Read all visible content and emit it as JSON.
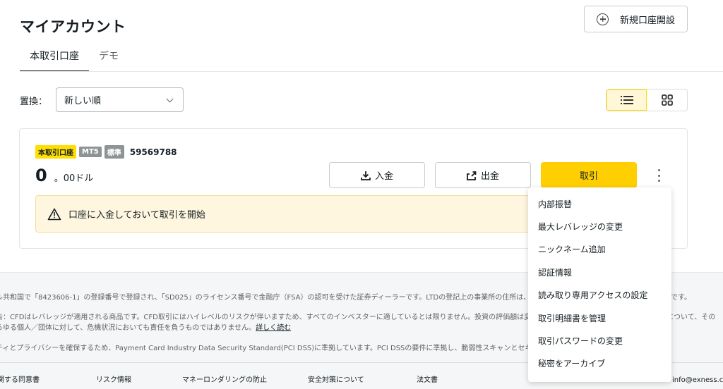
{
  "header": {
    "title": "マイアカウント",
    "new_account_label": "新規口座開設"
  },
  "tabs": [
    {
      "label": "本取引口座",
      "active": true
    },
    {
      "label": "デモ",
      "active": false
    }
  ],
  "sort": {
    "label": "置換：",
    "value": "新しい順"
  },
  "view_toggle": {
    "active": "list"
  },
  "account": {
    "badges": [
      "本取引口座",
      "MT5",
      "標準"
    ],
    "number": "59569788",
    "balance_int": "0",
    "balance_dec": "。00ドル",
    "deposit_label": "入金",
    "withdraw_label": "出金",
    "trade_label": "取引",
    "warning": "口座に入金しておいて取引を開始"
  },
  "menu": {
    "items": [
      "内部振替",
      "最大レバレッジの変更",
      "ニックネーム追加",
      "認証情報",
      "読み取り専用アクセスの設定",
      "取引明細書を管理",
      "取引パスワードの変更",
      "秘密をアーカイブ"
    ]
  },
  "footer": {
    "line1": "ル共和国で「8423606-1」の登録番号で登録され、「SD025」のライセンス番号で金融庁（FSA）の認可を受けた証券ディーラーです。LTDの登記上の事業所の住所は、9A CT Hou",
    "line1_tail": "です。",
    "line2": "告：CFDはレバレッジが適用される商品です。CFD取引にはハイレベルのリスクが伴いますため、すべてのインベスターに適しているとは限りません。投資の評価額は変動するものであり、投",
    "line2_tail": "について、その",
    "line3": "らゆる個人／団体に対して、危機状況においても責任を負うものではありません。",
    "line3_link": "詳しく読む",
    "line4": "ティとプライバシーを確保するため、Payment Card Industry Data Security Standard(PCI DSS)に準拠しています。PCI DSSの要件に準拠し、脆弱性スキャンとセキュリティテストを定期",
    "links": [
      "関する同意書",
      "リスク情報",
      "マネーロンダリングの防止",
      "安全対策について",
      "法文書"
    ],
    "email_partial": "info@exness.com"
  },
  "colors": {
    "accent": "#ffde02",
    "trade_button": "#ffcf02",
    "warning_bg": "#fff6e0"
  }
}
